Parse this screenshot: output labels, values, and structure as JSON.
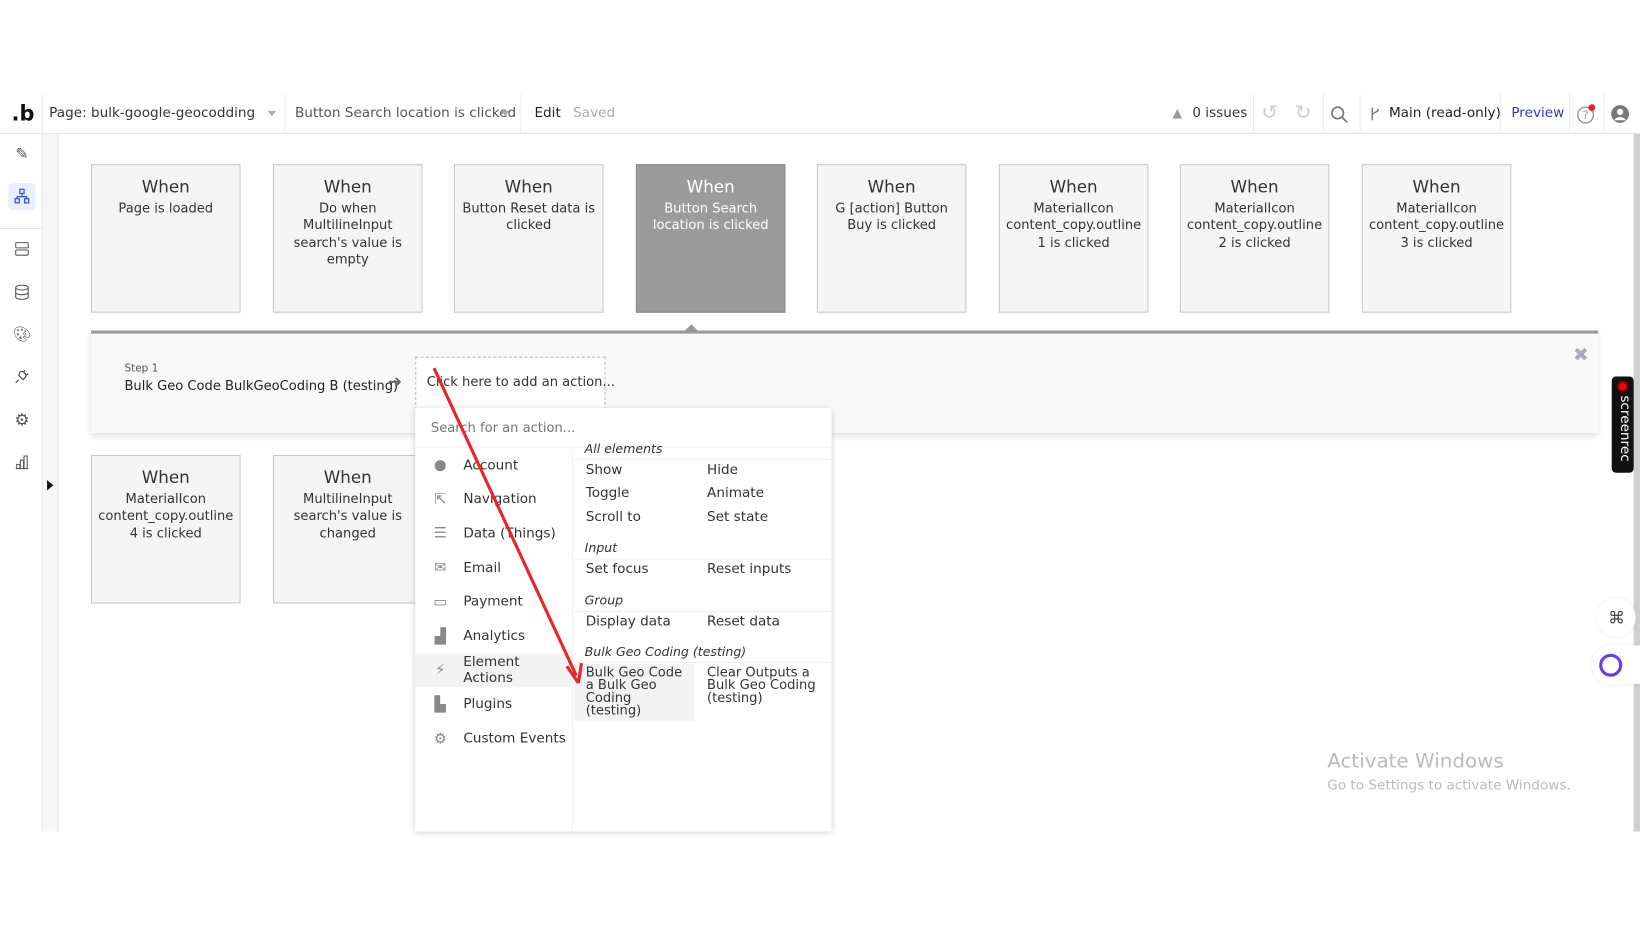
{
  "header": {
    "logo": ".b",
    "page_selector": "Page: bulk-google-geocodding",
    "event_selector": "Button Search location is clicked",
    "edit": "Edit",
    "saved": "Saved",
    "issues": "0 issues",
    "branch": "Main (read-only)",
    "preview": "Preview",
    "preview_color": "#2e3ab8"
  },
  "sidebar": {
    "items": [
      {
        "icon": "pencil-icon"
      },
      {
        "icon": "workflow-icon",
        "active": true
      },
      {
        "icon": "server-icon"
      },
      {
        "icon": "database-icon"
      },
      {
        "icon": "palette-icon"
      },
      {
        "icon": "plug-icon"
      },
      {
        "icon": "gear-icon"
      },
      {
        "icon": "bar-chart-icon"
      }
    ]
  },
  "events": [
    {
      "when": "When",
      "desc": "Page is loaded"
    },
    {
      "when": "When",
      "desc": "Do when MultilineInput search's value is empty"
    },
    {
      "when": "When",
      "desc": "Button Reset data is clicked"
    },
    {
      "when": "When",
      "desc": "Button Search location is clicked",
      "active": true
    },
    {
      "when": "When",
      "desc": "G [action] Button Buy is clicked"
    },
    {
      "when": "When",
      "desc": "MaterialIcon content_copy.outline 1 is clicked"
    },
    {
      "when": "When",
      "desc": "MaterialIcon content_copy.outline 2 is clicked"
    },
    {
      "when": "When",
      "desc": "MaterialIcon content_copy.outline 3 is clicked"
    },
    {
      "when": "When",
      "desc": "MaterialIcon content_copy.outline 4 is clicked"
    },
    {
      "when": "When",
      "desc": "MultilineInput search's value is changed"
    }
  ],
  "step": {
    "label": "Step 1",
    "name": "Bulk Geo Code BulkGeoCoding B (testing)",
    "add_action": "Click here to add an action..."
  },
  "menu": {
    "search_placeholder": "Search for an action...",
    "categories": [
      {
        "label": "Account",
        "icon": "account-icon"
      },
      {
        "label": "Navigation",
        "icon": "navigation-icon"
      },
      {
        "label": "Data (Things)",
        "icon": "database-icon"
      },
      {
        "label": "Email",
        "icon": "email-icon"
      },
      {
        "label": "Payment",
        "icon": "payment-icon"
      },
      {
        "label": "Analytics",
        "icon": "analytics-icon"
      },
      {
        "label": "Element Actions",
        "icon": "element-actions-icon",
        "selected": true
      },
      {
        "label": "Plugins",
        "icon": "plugins-icon"
      },
      {
        "label": "Custom Events",
        "icon": "custom-events-icon"
      }
    ],
    "sections": [
      {
        "title": "All elements",
        "actions": [
          "Show",
          "Hide",
          "Toggle",
          "Animate",
          "Scroll to",
          "Set state"
        ]
      },
      {
        "title": "Input",
        "actions": [
          "Set focus",
          "Reset inputs"
        ]
      },
      {
        "title": "Group",
        "actions": [
          "Display data",
          "Reset data"
        ]
      },
      {
        "title": "Bulk Geo Coding (testing)",
        "actions": [
          "Bulk Geo Code a Bulk Geo Coding (testing)",
          "Clear Outputs a Bulk Geo Coding (testing)"
        ]
      }
    ]
  },
  "watermark": {
    "line1": "Activate Windows",
    "line2": "Go to Settings to activate Windows."
  },
  "screenrec": "screenrec",
  "annotation_color": "#e8262a"
}
